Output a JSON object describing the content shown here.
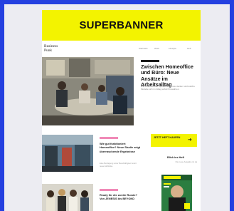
{
  "banner": {
    "label": "SUPERBANNER"
  },
  "site": {
    "logo": [
      "Business",
      "Punk"
    ],
    "nav": [
      "Startseite",
      "Work",
      "Lifestyle",
      "Heft"
    ]
  },
  "hero": {
    "title": "Zwischen Homeoffice und Büro: Neue Ansätze im Arbeitsalltag",
    "text": "Wie Unternehmen hybride Arbeit neu denken und welche Modelle sich im Alltag wirklich bewähren."
  },
  "cards": [
    {
      "title": "Wie gut funktioniert Homeoffice? Neue Studie zeigt überraschende Ergebnisse",
      "text": "Eine Befragung unter Beschäftigten liefert neue Einblicke."
    },
    {
      "title": "Ready für die zweite Runde? Von JENESIS bis BEYOND",
      "text": ""
    }
  ],
  "sidebar": {
    "cta_label": "JETZT HEFT KAUFEN",
    "issue_title": "Blick ins Heft",
    "issue_text": "Die neue Ausgabe ist da"
  },
  "colors": {
    "background": "#2440e0",
    "accent_yellow": "#f3f300",
    "tag_pink": "#f08ab7"
  }
}
